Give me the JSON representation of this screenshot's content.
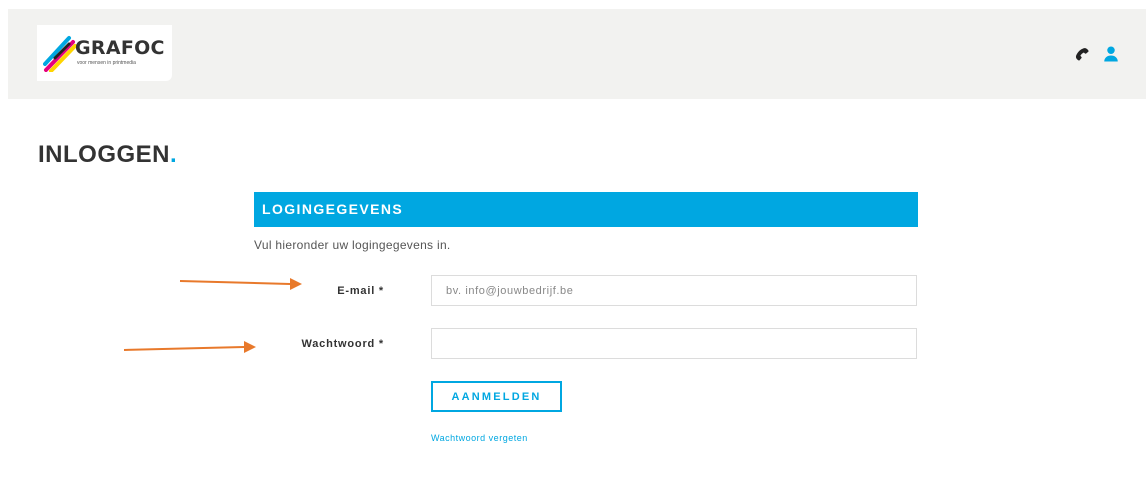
{
  "header": {
    "logo": {
      "name": "GRAFOC",
      "tagline": "voor mensen in printmedia"
    },
    "icons": [
      "phone-icon",
      "user-icon"
    ]
  },
  "page": {
    "title": "INLOGGEN",
    "title_dot": "."
  },
  "login": {
    "section_title": "LOGINGEGEVENS",
    "intro": "Vul hieronder uw logingegevens in.",
    "email": {
      "label": "E-mail *",
      "placeholder": "bv. info@jouwbedrijf.be",
      "value": ""
    },
    "password": {
      "label": "Wachtwoord *",
      "placeholder": "",
      "value": ""
    },
    "submit_label": "AANMELDEN",
    "forgot_label": "Wachtwoord vergeten"
  },
  "colors": {
    "accent": "#00a7e1",
    "header_bg": "#f2f2f0",
    "annotation_arrow": "#e8792b"
  }
}
